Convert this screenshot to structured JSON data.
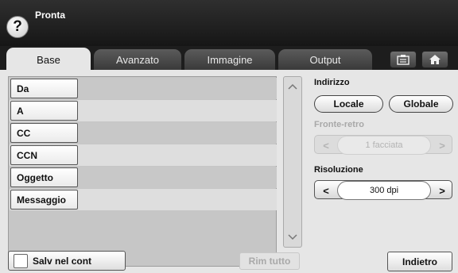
{
  "header": {
    "title": "Pronta",
    "help_icon": "?"
  },
  "tabs": [
    {
      "label": "Base",
      "active": true
    },
    {
      "label": "Avanzato",
      "active": false
    },
    {
      "label": "Immagine",
      "active": false
    },
    {
      "label": "Output",
      "active": false
    }
  ],
  "tab_icons": {
    "job_icon": "clipboard-icon",
    "home_icon": "home-icon"
  },
  "fields": [
    {
      "label": "Da",
      "value": ""
    },
    {
      "label": "A",
      "value": ""
    },
    {
      "label": "CC",
      "value": ""
    },
    {
      "label": "CCN",
      "value": ""
    },
    {
      "label": "Oggetto",
      "value": ""
    },
    {
      "label": "Messaggio",
      "value": ""
    }
  ],
  "scroll": {
    "up": "⌃",
    "down": "⌄"
  },
  "address": {
    "label": "Indirizzo",
    "local": "Locale",
    "global": "Globale"
  },
  "duplex": {
    "label": "Fronte-retro",
    "value": "1 facciata",
    "prev": "<",
    "next": ">",
    "enabled": false
  },
  "resolution": {
    "label": "Risoluzione",
    "value": "300 dpi",
    "prev": "<",
    "next": ">",
    "enabled": true
  },
  "footer": {
    "save_label": "Salv nel cont",
    "clear_label": "Rim tutto",
    "back_label": "Indietro"
  },
  "colors": {
    "titlebar": "#1e1e1e",
    "panel": "#e6e6e6",
    "disabled_text": "#a8a8a8"
  }
}
